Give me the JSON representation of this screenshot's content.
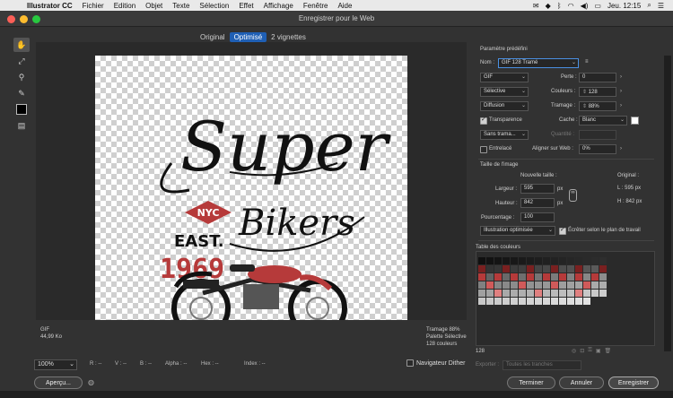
{
  "menubar": {
    "app_name": "Illustrator CC",
    "menus": [
      "Fichier",
      "Edition",
      "Objet",
      "Texte",
      "Sélection",
      "Effet",
      "Affichage",
      "Fenêtre",
      "Aide"
    ],
    "clock": "Jeu. 12:15"
  },
  "window": {
    "title": "Enregistrer pour le Web"
  },
  "view_tabs": [
    "Original",
    "Optimisé",
    "2 vignettes"
  ],
  "active_tab": "Optimisé",
  "artwork": {
    "line1": "Super",
    "badge": "NYC",
    "line2": "EAST.",
    "line3": "Bikers",
    "year": "1969",
    "colors": {
      "red": "#b63a3a",
      "black": "#111111"
    }
  },
  "preview_info": {
    "format": "GIF",
    "size": "44,99 Ko",
    "dither": "Tramage 88%",
    "palette": "Palette Sélective",
    "colors": "128 couleurs"
  },
  "status_bar": {
    "zoom": "100%",
    "r": "R : --",
    "v": "V : --",
    "b": "B : --",
    "alpha": "Alpha : --",
    "hex": "Hex : --",
    "index": "Index : --",
    "navigator": "Navigateur Dither"
  },
  "buttons": {
    "apercu": "Aperçu...",
    "terminer": "Terminer",
    "annuler": "Annuler",
    "enregistrer": "Enregistrer"
  },
  "settings": {
    "preset_header": "Paramètre prédéfini",
    "name_label": "Nom :",
    "name_value": "GIF 128 Tramé",
    "format_value": "GIF",
    "perte_label": "Perte :",
    "perte_value": "0",
    "reduction_value": "Sélective",
    "couleurs_label": "Couleurs :",
    "couleurs_value": "128",
    "dither_value": "Diffusion",
    "tramage_label": "Tramage :",
    "tramage_value": "88%",
    "transparence_label": "Transparence",
    "cache_label": "Cache :",
    "cache_value": "Blanc",
    "trans_dither_value": "Sans trama...",
    "quantite_label": "Quantité :",
    "entrelace_label": "Entrelacé",
    "web_snap_label": "Aligner sur Web :",
    "web_snap_value": "0%"
  },
  "image_size": {
    "header": "Taille de l'image",
    "new_size_label": "Nouvelle taille :",
    "original_label": "Original :",
    "largeur_label": "Largeur :",
    "largeur_value": "595",
    "hauteur_label": "Hauteur :",
    "hauteur_value": "842",
    "unit": "px",
    "pourcentage_label": "Pourcentage :",
    "pourcentage_value": "100",
    "orig_w": "L : 595 px",
    "orig_h": "H : 842 px",
    "quality_value": "Illustration optimisée",
    "clip_label": "Écrêter selon le plan de travail"
  },
  "color_table": {
    "header": "Table des couleurs",
    "count": "128",
    "export_label": "Exporter :",
    "export_value": "Toutes les tranches"
  }
}
